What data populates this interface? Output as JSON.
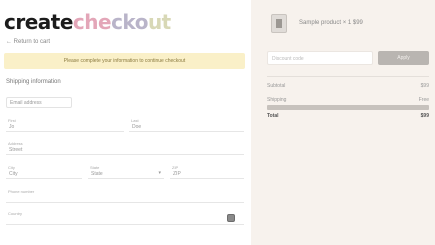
{
  "brand": {
    "logo_part1": "create",
    "logo_part2": "che",
    "logo_part3": "cko",
    "logo_part4": "ut",
    "colors": {
      "dark": "#1c1c1c",
      "pink": "#e3a6b8",
      "lavender": "#b9b4c9",
      "khaki": "#d8d8b6"
    }
  },
  "nav": {
    "back_label": "← Return to cart"
  },
  "notice": {
    "text": "Please complete your information to continue checkout"
  },
  "form": {
    "section_title": "Shipping information",
    "fields": {
      "email": {
        "label": "",
        "value": "Email address"
      },
      "first_name": {
        "label": "First",
        "value": "Jo"
      },
      "last_name": {
        "label": "Last",
        "value": "Doe"
      },
      "address": {
        "label": "Address",
        "value": "Street"
      },
      "city": {
        "label": "City",
        "value": "City"
      },
      "state": {
        "label": "State",
        "value": "State"
      },
      "zip": {
        "label": "ZIP",
        "value": "ZIP"
      },
      "phone": {
        "label": "Phone number",
        "value": ""
      },
      "country": {
        "label": "Country",
        "value": ""
      }
    }
  },
  "summary": {
    "item_name": "Sample product   × 1   $99",
    "coupon_placeholder": "Discount code",
    "coupon_button": "Apply",
    "subtotal_label": "Subtotal",
    "subtotal_value": "$99",
    "shipping_label": "Shipping",
    "shipping_value": "Free",
    "total_label": "Total",
    "total_value": "$99"
  }
}
